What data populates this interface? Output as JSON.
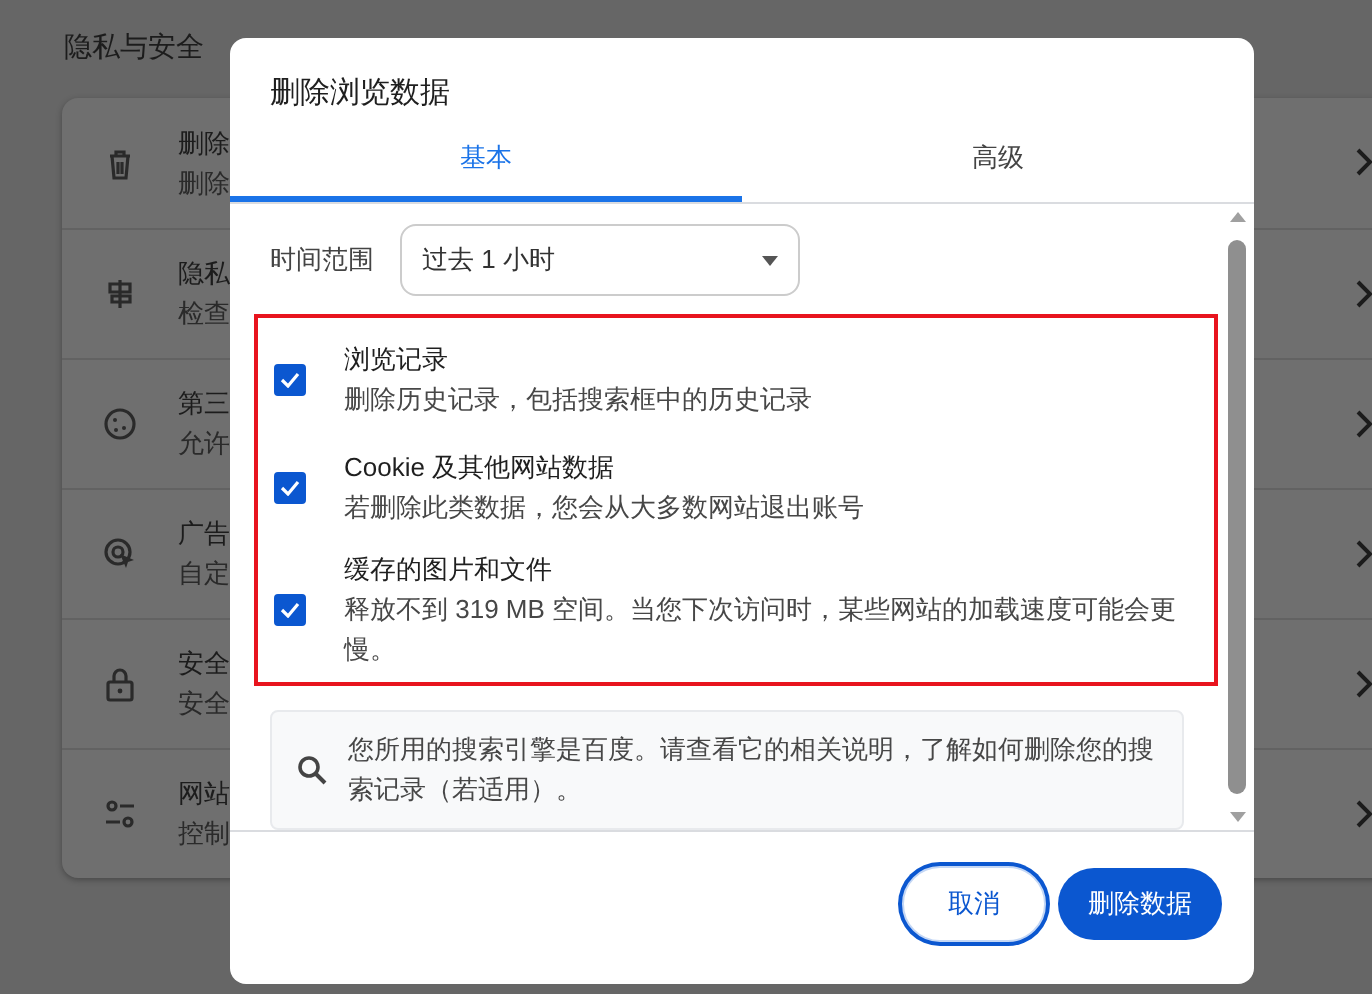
{
  "page": {
    "title": "隐私与安全",
    "items": [
      {
        "title": "删除",
        "subtitle": "删除"
      },
      {
        "title": "隐私",
        "subtitle": "检查"
      },
      {
        "title": "第三",
        "subtitle": "允许"
      },
      {
        "title": "广告",
        "subtitle": "自定"
      },
      {
        "title": "安全",
        "subtitle": "安全"
      },
      {
        "title": "网站",
        "subtitle": "控制"
      }
    ]
  },
  "dialog": {
    "title": "删除浏览数据",
    "tabs": [
      {
        "label": "基本",
        "selected": true
      },
      {
        "label": "高级",
        "selected": false
      }
    ],
    "time_range": {
      "label": "时间范围",
      "value": "过去 1 小时"
    },
    "highlighted": true,
    "options": [
      {
        "title": "浏览记录",
        "description": "删除历史记录，包括搜索框中的历史记录",
        "checked": true
      },
      {
        "title": "Cookie 及其他网站数据",
        "description": "若删除此类数据，您会从大多数网站退出账号",
        "checked": true
      },
      {
        "title": "缓存的图片和文件",
        "description": "释放不到 319 MB 空间。当您下次访问时，某些网站的加载速度可能会更慢。",
        "checked": true
      }
    ],
    "info": "您所用的搜索引擎是百度。请查看它的相关说明，了解如何删除您的搜索记录（若适用）。",
    "buttons": [
      {
        "label": "取消",
        "kind": "secondary"
      },
      {
        "label": "删除数据",
        "kind": "primary"
      }
    ]
  }
}
